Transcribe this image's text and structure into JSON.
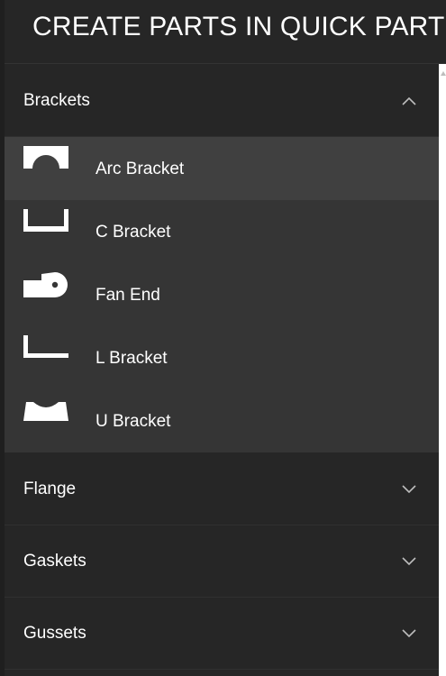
{
  "header": {
    "title": "CREATE PARTS IN QUICK PART"
  },
  "sections": [
    {
      "label": "Brackets",
      "expanded": true,
      "chevron_icon": "chevron-up-icon",
      "items": [
        {
          "label": "Arc Bracket",
          "icon": "arc-bracket-icon",
          "active": true
        },
        {
          "label": "C Bracket",
          "icon": "c-bracket-icon",
          "active": false
        },
        {
          "label": "Fan End",
          "icon": "fan-end-icon",
          "active": false
        },
        {
          "label": "L Bracket",
          "icon": "l-bracket-icon",
          "active": false
        },
        {
          "label": "U Bracket",
          "icon": "u-bracket-icon",
          "active": false
        }
      ]
    },
    {
      "label": "Flange",
      "expanded": false,
      "chevron_icon": "chevron-down-icon"
    },
    {
      "label": "Gaskets",
      "expanded": false,
      "chevron_icon": "chevron-down-icon"
    },
    {
      "label": "Gussets",
      "expanded": false,
      "chevron_icon": "chevron-down-icon"
    }
  ],
  "colors": {
    "background": "#262626",
    "items_background": "#353535",
    "active_item": "#404040",
    "text": "#ffffff",
    "icon": "#ffffff",
    "chevron": "#bdbdbd"
  }
}
